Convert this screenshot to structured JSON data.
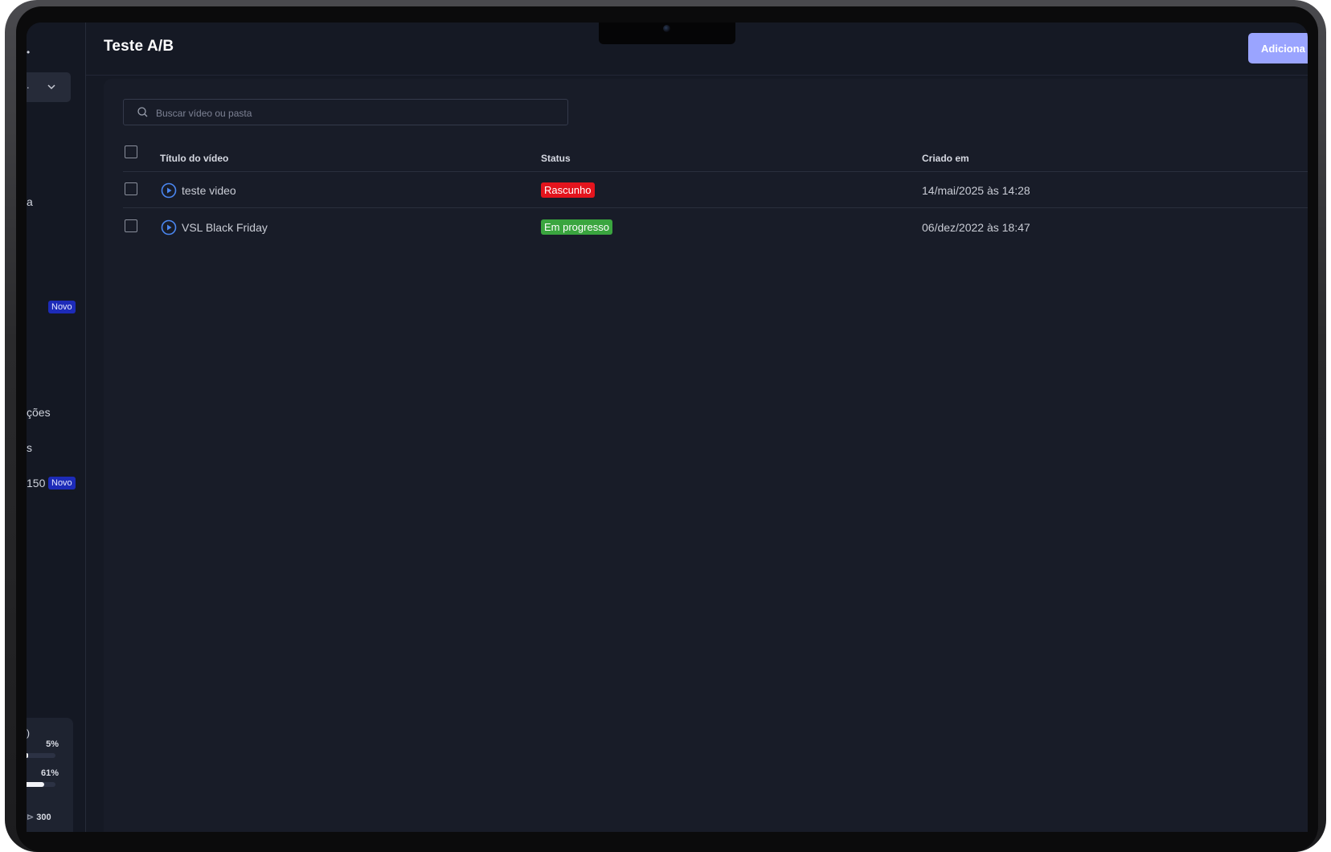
{
  "sidebar": {
    "select_fragment": ".",
    "item_a": "a",
    "novo_badge_1": "Novo",
    "item_coes": "ções",
    "item_s": "s",
    "item_150": "150",
    "novo_badge_2": "Novo",
    "usage": {
      "zero_text": ")",
      "pct_1": "5%",
      "pct_1_value": 5,
      "pct_2": "61%",
      "pct_2_value": 61,
      "credits": "300"
    }
  },
  "header": {
    "title": "Teste A/B",
    "add_button": "Adiciona"
  },
  "search": {
    "placeholder": "Buscar vídeo ou pasta",
    "value": ""
  },
  "table": {
    "headers": {
      "title": "Título do vídeo",
      "status": "Status",
      "created": "Criado em"
    },
    "rows": [
      {
        "title": "teste video",
        "status": "Rascunho",
        "status_color": "#e3141d",
        "created": "14/mai/2025 às 14:28"
      },
      {
        "title": "VSL Black Friday",
        "status": "Em progresso",
        "status_color": "#3aa53f",
        "created": "06/dez/2022 às 18:47"
      }
    ]
  },
  "colors": {
    "background": "#151924",
    "panel": "#181c28",
    "accent": "#9aa4ff",
    "play_icon": "#4a86f0"
  }
}
